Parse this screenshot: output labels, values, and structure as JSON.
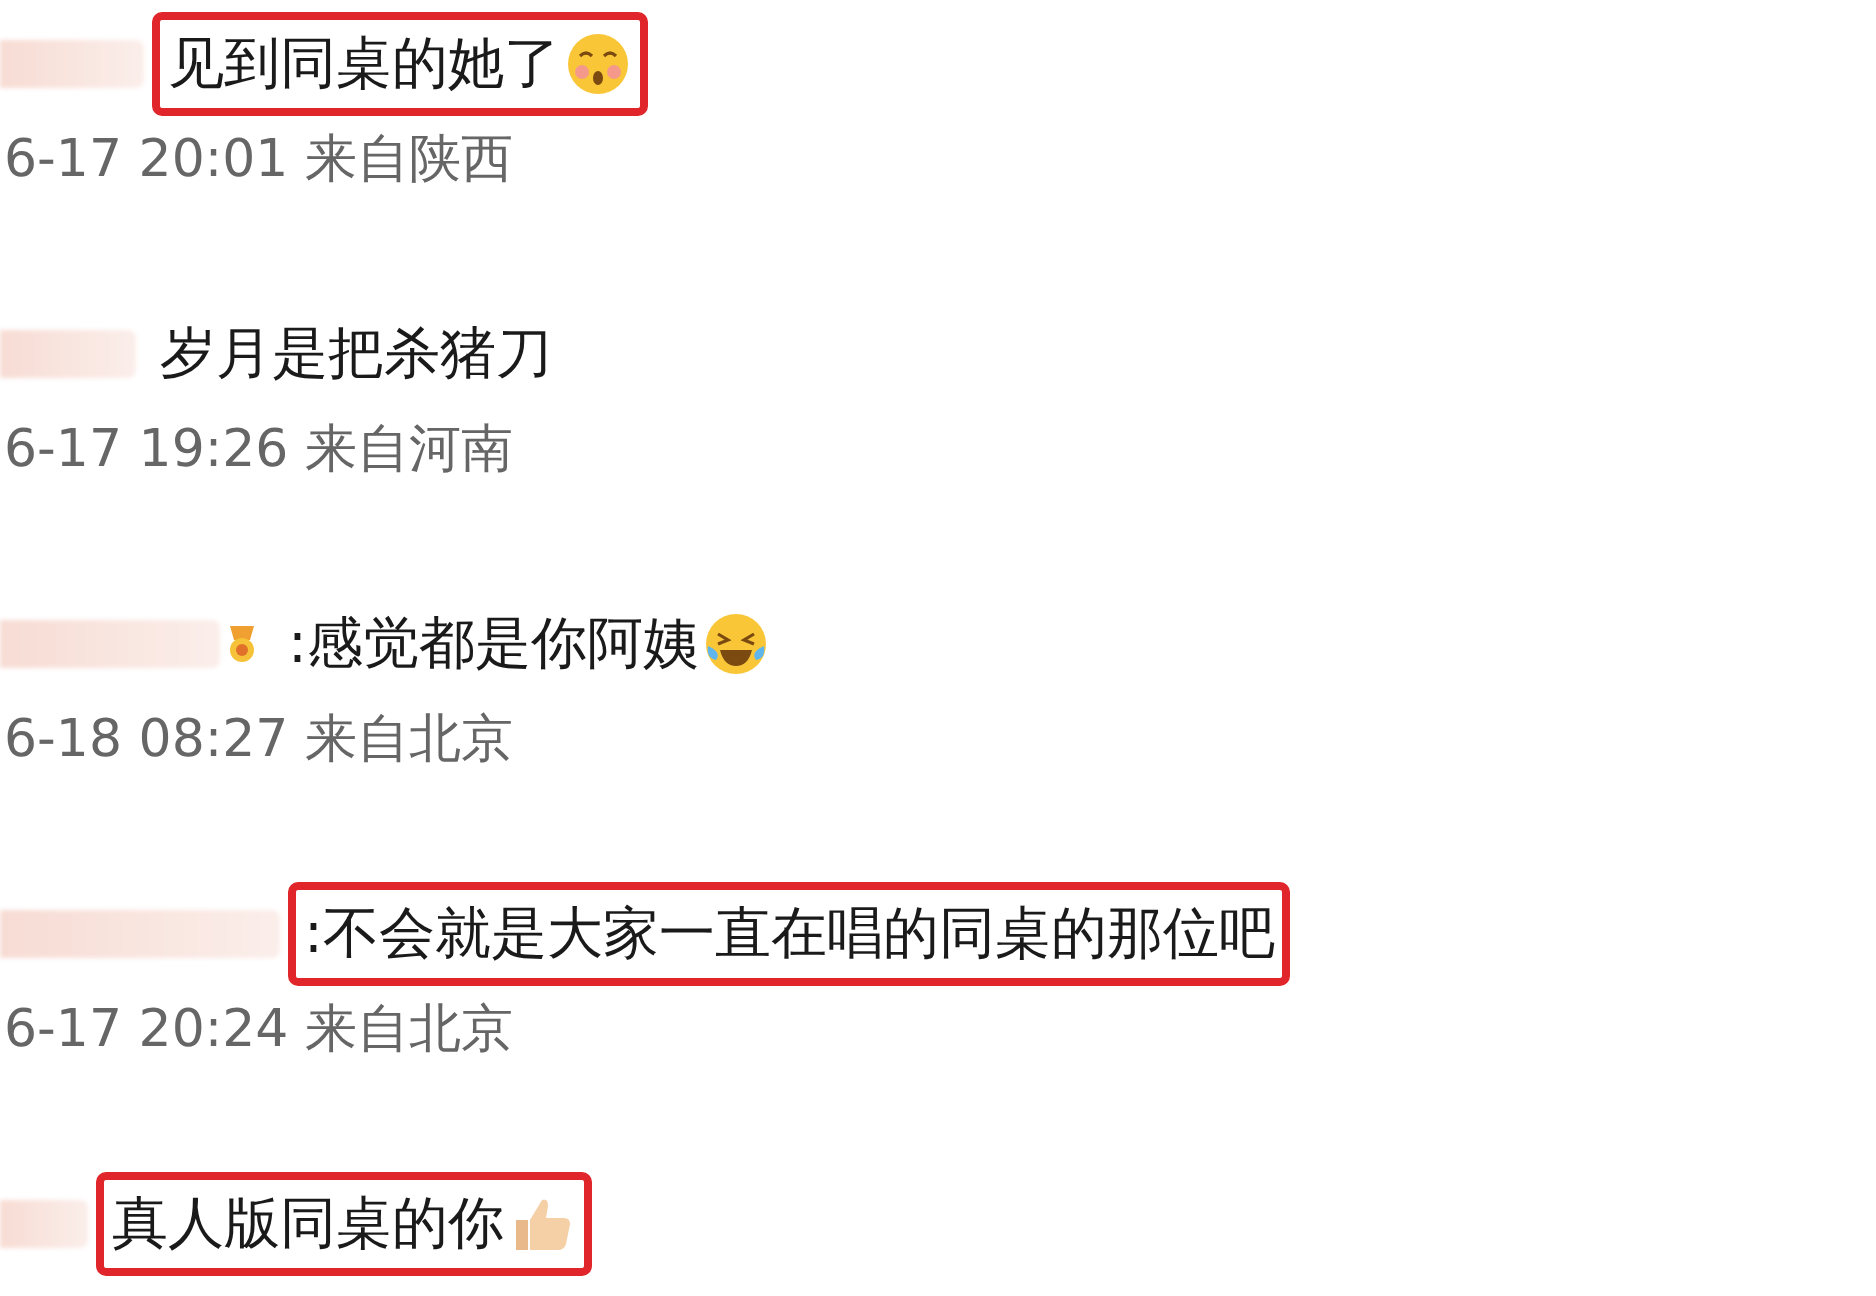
{
  "comments": [
    {
      "text": "见到同桌的她了",
      "emoji": {
        "kind": "flushed"
      },
      "name_badge": false,
      "highlighted": true,
      "meta": "6-17 20:01 来自陕西"
    },
    {
      "text": "岁月是把杀猪刀",
      "name_badge": false,
      "highlighted": false,
      "meta": "6-17 19:26 来自河南"
    },
    {
      "text": ":感觉都是你阿姨",
      "emoji": {
        "kind": "laughing"
      },
      "name_badge": true,
      "highlighted": false,
      "meta": "6-18 08:27 来自北京"
    },
    {
      "text": ":不会就是大家一直在唱的同桌的那位吧",
      "name_badge": false,
      "highlighted": true,
      "meta": "6-17 20:24 来自北京"
    },
    {
      "text": "真人版同桌的你",
      "emoji": {
        "kind": "thumbs_up"
      },
      "name_badge": false,
      "highlighted": true
    }
  ]
}
